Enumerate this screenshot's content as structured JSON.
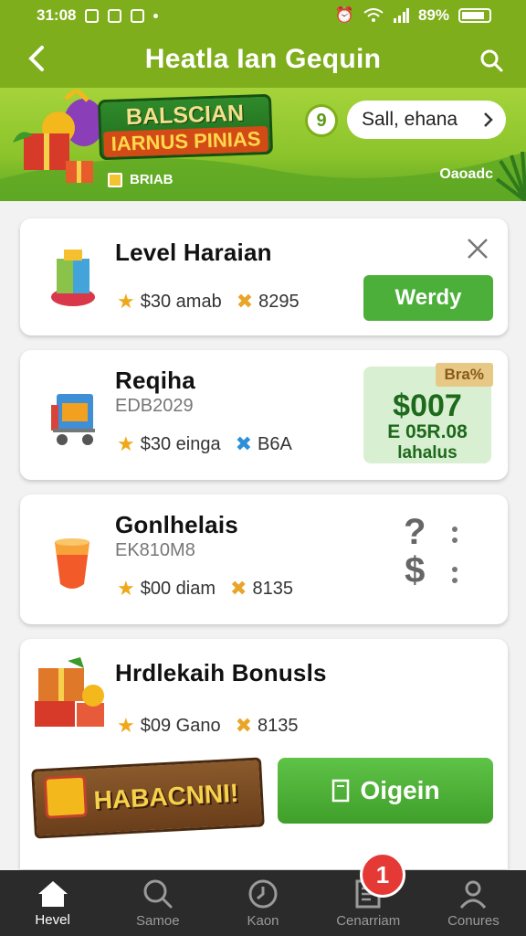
{
  "status_bar": {
    "time": "31:08",
    "battery": "89%"
  },
  "header": {
    "title": "Heatla Ian Gequin"
  },
  "banner": {
    "sign_top": "BALSCIAN",
    "sign_bottom": "IARNUS PINIAS",
    "sub_label": "BRIAB",
    "pin_label": "9",
    "pill_text": "Sall, ehana",
    "right_label": "Oaoadc"
  },
  "cards": [
    {
      "title": "Level Haraian",
      "stat1": "$30 amab",
      "stat2": "8295",
      "button": "Werdy"
    },
    {
      "title": "Reqiha",
      "sub": "EDB2029",
      "stat1": "$30 einga",
      "stat2": "B6A",
      "price": {
        "badge": "Bra%",
        "amount": "$007",
        "line2": "E 05R.08",
        "line3": "lahalus"
      }
    },
    {
      "title": "Gonlhelais",
      "sub": "EK810M8",
      "stat1": "$00 diam",
      "stat2": "8135"
    },
    {
      "title": "Hrdlekaih Bonusls",
      "stat1": "$09 Gano",
      "stat2": "8135",
      "plaque": "HABACNNI!",
      "button": "Oigein"
    }
  ],
  "nav": [
    {
      "label": "Hevel",
      "icon": "home-icon"
    },
    {
      "label": "Samoe",
      "icon": "search-icon"
    },
    {
      "label": "Kaon",
      "icon": "clock-icon"
    },
    {
      "label": "Cenarriam",
      "icon": "list-icon"
    },
    {
      "label": "Conures",
      "icon": "profile-icon"
    }
  ],
  "nav_badge": "1",
  "colors": {
    "accent": "#7fae1c",
    "button_green": "#4caf3a",
    "badge_red": "#e53935"
  }
}
